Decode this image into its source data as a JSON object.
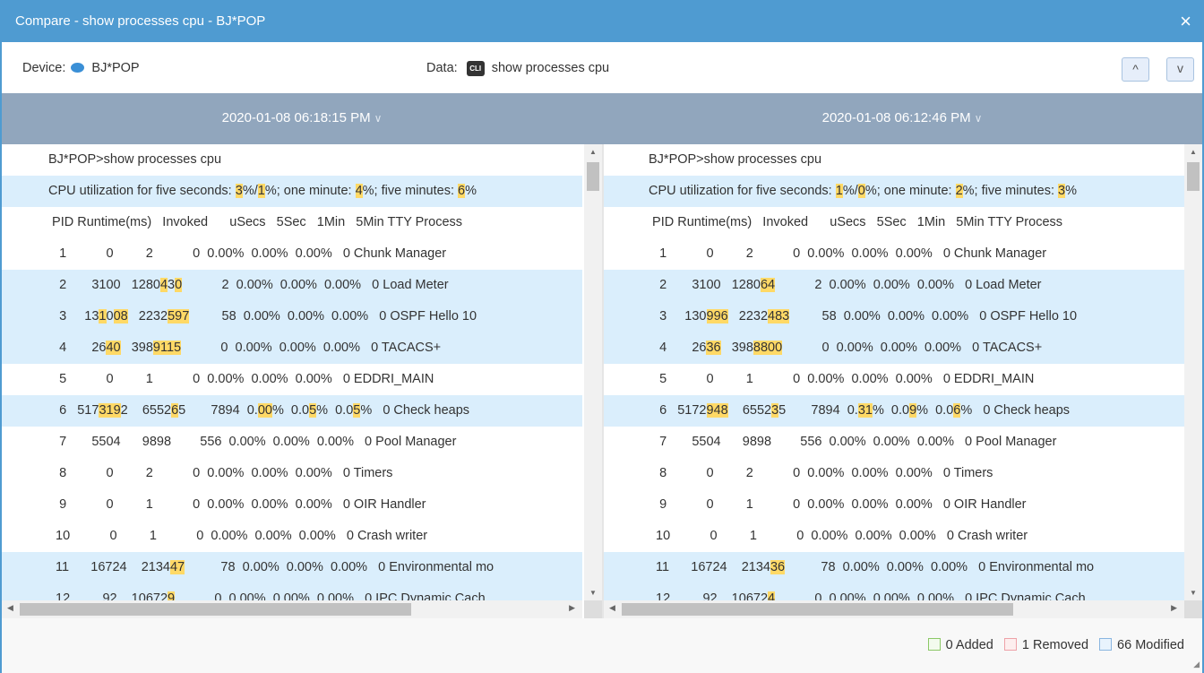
{
  "window": {
    "title": "Compare - show processes cpu - BJ*POP",
    "close_icon": "×"
  },
  "info": {
    "device_label": "Device:",
    "device_name": "BJ*POP",
    "data_label": "Data:",
    "cli_badge": "CLI",
    "data_value": "show processes cpu",
    "prev_label": "^",
    "next_label": "v"
  },
  "colors": {
    "titlebar": "#4f9bd1",
    "modified_row": "#daeefc",
    "highlight": "#ffd966",
    "header": "#91a6bd"
  },
  "panels": [
    {
      "timestamp": "2020-01-08 06:18:15 PM",
      "chevron": "∨",
      "lines": [
        {
          "mod": false,
          "segs": [
            {
              "t": "BJ*POP>show processes cpu"
            }
          ]
        },
        {
          "mod": true,
          "segs": [
            {
              "t": "CPU utilization for five seconds: "
            },
            {
              "t": "3",
              "h": true
            },
            {
              "t": "%/"
            },
            {
              "t": "1",
              "h": true
            },
            {
              "t": "%; one minute: "
            },
            {
              "t": "4",
              "h": true
            },
            {
              "t": "%; five minutes: "
            },
            {
              "t": "6",
              "h": true
            },
            {
              "t": "%"
            }
          ]
        },
        {
          "mod": false,
          "segs": [
            {
              "t": " PID Runtime(ms)   Invoked      uSecs   5Sec   1Min   5Min TTY Process"
            }
          ]
        },
        {
          "mod": false,
          "segs": [
            {
              "t": "   1           0         2           0  0.00%  0.00%  0.00%   0 Chunk Manager"
            }
          ]
        },
        {
          "mod": true,
          "segs": [
            {
              "t": "   2       3100   1280"
            },
            {
              "t": "4",
              "h": true
            },
            {
              "t": "3"
            },
            {
              "t": "0",
              "h": true
            },
            {
              "t": "           2  0.00%  0.00%  0.00%   0 Load Meter"
            }
          ]
        },
        {
          "mod": true,
          "segs": [
            {
              "t": "   3     13"
            },
            {
              "t": "1",
              "h": true
            },
            {
              "t": "0"
            },
            {
              "t": "08",
              "h": true
            },
            {
              "t": "   2232"
            },
            {
              "t": "597",
              "h": true
            },
            {
              "t": "         58  0.00%  0.00%  0.00%   0 OSPF Hello 10"
            }
          ]
        },
        {
          "mod": true,
          "segs": [
            {
              "t": "   4       26"
            },
            {
              "t": "40",
              "h": true
            },
            {
              "t": "   398"
            },
            {
              "t": "9115",
              "h": true
            },
            {
              "t": "           0  0.00%  0.00%  0.00%   0 TACACS+"
            }
          ]
        },
        {
          "mod": false,
          "segs": [
            {
              "t": "   5           0         1           0  0.00%  0.00%  0.00%   0 EDDRI_MAIN"
            }
          ]
        },
        {
          "mod": true,
          "segs": [
            {
              "t": "   6   517"
            },
            {
              "t": "319",
              "h": true
            },
            {
              "t": "2    6552"
            },
            {
              "t": "6",
              "h": true
            },
            {
              "t": "5       7894  0."
            },
            {
              "t": "00",
              "h": true
            },
            {
              "t": "%  0.0"
            },
            {
              "t": "5",
              "h": true
            },
            {
              "t": "%  0.0"
            },
            {
              "t": "5",
              "h": true
            },
            {
              "t": "%   0 Check heaps"
            }
          ]
        },
        {
          "mod": false,
          "segs": [
            {
              "t": "   7       5504      9898        556  0.00%  0.00%  0.00%   0 Pool Manager"
            }
          ]
        },
        {
          "mod": false,
          "segs": [
            {
              "t": "   8           0         2           0  0.00%  0.00%  0.00%   0 Timers"
            }
          ]
        },
        {
          "mod": false,
          "segs": [
            {
              "t": "   9           0         1           0  0.00%  0.00%  0.00%   0 OIR Handler"
            }
          ]
        },
        {
          "mod": false,
          "segs": [
            {
              "t": "  10           0         1           0  0.00%  0.00%  0.00%   0 Crash writer"
            }
          ]
        },
        {
          "mod": true,
          "segs": [
            {
              "t": "  11      16724    2134"
            },
            {
              "t": "47",
              "h": true
            },
            {
              "t": "          78  0.00%  0.00%  0.00%   0 Environmental mo"
            }
          ]
        },
        {
          "mod": true,
          "segs": [
            {
              "t": "  12         92    10672"
            },
            {
              "t": "9",
              "h": true
            },
            {
              "t": "           0  0.00%  0.00%  0.00%   0 IPC Dynamic Cach"
            }
          ]
        }
      ]
    },
    {
      "timestamp": "2020-01-08 06:12:46 PM",
      "chevron": "∨",
      "lines": [
        {
          "mod": false,
          "segs": [
            {
              "t": "BJ*POP>show processes cpu"
            }
          ]
        },
        {
          "mod": true,
          "segs": [
            {
              "t": "CPU utilization for five seconds: "
            },
            {
              "t": "1",
              "h": true
            },
            {
              "t": "%/"
            },
            {
              "t": "0",
              "h": true
            },
            {
              "t": "%; one minute: "
            },
            {
              "t": "2",
              "h": true
            },
            {
              "t": "%; five minutes: "
            },
            {
              "t": "3",
              "h": true
            },
            {
              "t": "%"
            }
          ]
        },
        {
          "mod": false,
          "segs": [
            {
              "t": " PID Runtime(ms)   Invoked      uSecs   5Sec   1Min   5Min TTY Process"
            }
          ]
        },
        {
          "mod": false,
          "segs": [
            {
              "t": "   1           0         2           0  0.00%  0.00%  0.00%   0 Chunk Manager"
            }
          ]
        },
        {
          "mod": true,
          "segs": [
            {
              "t": "   2       3100   1280"
            },
            {
              "t": "64",
              "h": true
            },
            {
              "t": "           2  0.00%  0.00%  0.00%   0 Load Meter"
            }
          ]
        },
        {
          "mod": true,
          "segs": [
            {
              "t": "   3     130"
            },
            {
              "t": "996",
              "h": true
            },
            {
              "t": "   2232"
            },
            {
              "t": "483",
              "h": true
            },
            {
              "t": "         58  0.00%  0.00%  0.00%   0 OSPF Hello 10"
            }
          ]
        },
        {
          "mod": true,
          "segs": [
            {
              "t": "   4       26"
            },
            {
              "t": "36",
              "h": true
            },
            {
              "t": "   398"
            },
            {
              "t": "8800",
              "h": true
            },
            {
              "t": "           0  0.00%  0.00%  0.00%   0 TACACS+"
            }
          ]
        },
        {
          "mod": false,
          "segs": [
            {
              "t": "   5           0         1           0  0.00%  0.00%  0.00%   0 EDDRI_MAIN"
            }
          ]
        },
        {
          "mod": true,
          "segs": [
            {
              "t": "   6   5172"
            },
            {
              "t": "948",
              "h": true
            },
            {
              "t": "    6552"
            },
            {
              "t": "3",
              "h": true
            },
            {
              "t": "5       7894  0."
            },
            {
              "t": "31",
              "h": true
            },
            {
              "t": "%  0.0"
            },
            {
              "t": "9",
              "h": true
            },
            {
              "t": "%  0.0"
            },
            {
              "t": "6",
              "h": true
            },
            {
              "t": "%   0 Check heaps"
            }
          ]
        },
        {
          "mod": false,
          "segs": [
            {
              "t": "   7       5504      9898        556  0.00%  0.00%  0.00%   0 Pool Manager"
            }
          ]
        },
        {
          "mod": false,
          "segs": [
            {
              "t": "   8           0         2           0  0.00%  0.00%  0.00%   0 Timers"
            }
          ]
        },
        {
          "mod": false,
          "segs": [
            {
              "t": "   9           0         1           0  0.00%  0.00%  0.00%   0 OIR Handler"
            }
          ]
        },
        {
          "mod": false,
          "segs": [
            {
              "t": "  10           0         1           0  0.00%  0.00%  0.00%   0 Crash writer"
            }
          ]
        },
        {
          "mod": true,
          "segs": [
            {
              "t": "  11      16724    2134"
            },
            {
              "t": "36",
              "h": true
            },
            {
              "t": "          78  0.00%  0.00%  0.00%   0 Environmental mo"
            }
          ]
        },
        {
          "mod": true,
          "segs": [
            {
              "t": "  12         92    10672"
            },
            {
              "t": "4",
              "h": true
            },
            {
              "t": "           0  0.00%  0.00%  0.00%   0 IPC Dynamic Cach"
            }
          ]
        }
      ]
    }
  ],
  "legend": {
    "added": {
      "label": "0 Added",
      "color": "#8cc867",
      "fill": "#f3fbee"
    },
    "removed": {
      "label": "1 Removed",
      "color": "#eea2a8",
      "fill": "#fdeeee"
    },
    "modified": {
      "label": "66 Modified",
      "color": "#8ab6e0",
      "fill": "#e8f3fd"
    }
  }
}
